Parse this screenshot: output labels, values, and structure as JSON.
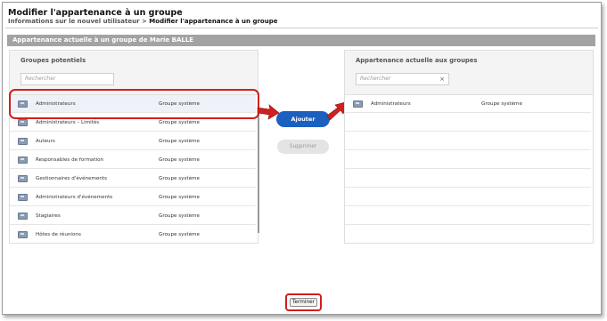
{
  "page": {
    "title": "Modifier l'appartenance à un groupe",
    "breadcrumb_parent": "Informations sur le nouvel utilisateur",
    "breadcrumb_separator": ">",
    "breadcrumb_current": "Modifier l'appartenance à un groupe"
  },
  "section_title": "Appartenance actuelle à un groupe de Marie BALLE",
  "left_panel": {
    "title": "Groupes potentiels",
    "search_placeholder": "Rechercher",
    "rows": [
      {
        "name": "Administrateurs",
        "type": "Groupe système"
      },
      {
        "name": "Administrateurs – Limités",
        "type": "Groupe système"
      },
      {
        "name": "Auteurs",
        "type": "Groupe système"
      },
      {
        "name": "Responsables de formation",
        "type": "Groupe système"
      },
      {
        "name": "Gestionnaires d'événements",
        "type": "Groupe système"
      },
      {
        "name": "Administrateurs d'événements",
        "type": "Groupe système"
      },
      {
        "name": "Stagiaires",
        "type": "Groupe système"
      },
      {
        "name": "Hôtes de réunions",
        "type": "Groupe système"
      }
    ]
  },
  "right_panel": {
    "title": "Appartenance actuelle aux groupes",
    "search_placeholder": "Rechercher",
    "clear_icon": "×",
    "rows": [
      {
        "name": "Administrateurs",
        "type": "Groupe système"
      }
    ]
  },
  "buttons": {
    "add": "Ajouter",
    "remove": "Supprimer",
    "finish": "Terminer"
  },
  "colors": {
    "accent_blue": "#1b5fbf",
    "annotation_red": "#d21f1f",
    "section_bar": "#a3a3a3"
  }
}
